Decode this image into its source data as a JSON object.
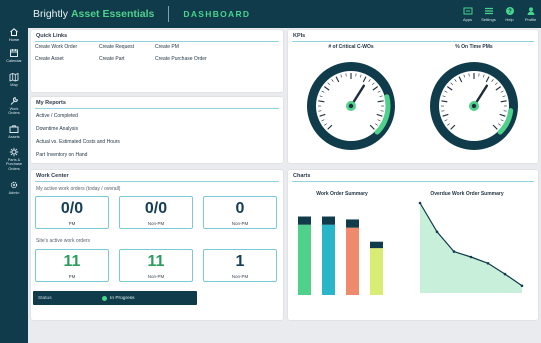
{
  "app": {
    "brand_light": "Brightly ",
    "brand_bold": "Asset Essentials",
    "page": "DASHBOARD"
  },
  "top_actions": [
    {
      "label": "Apps",
      "icon": "apps-icon"
    },
    {
      "label": "Settings",
      "icon": "settings-icon"
    },
    {
      "label": "Help",
      "icon": "help-icon"
    },
    {
      "label": "Profile",
      "icon": "profile-icon"
    }
  ],
  "sidebar": {
    "items": [
      {
        "label": "Menu",
        "icon": "hamburger-icon"
      },
      {
        "label": "Home",
        "icon": "home-icon"
      },
      {
        "label": "Calendar",
        "icon": "calendar-icon"
      },
      {
        "label": "Map",
        "icon": "map-icon"
      },
      {
        "label": "Work Orders",
        "icon": "wrench-icon"
      },
      {
        "label": "Assets",
        "icon": "briefcase-icon"
      },
      {
        "label": "Parts & Purchase Orders",
        "icon": "gear-icon"
      },
      {
        "label": "Admin",
        "icon": "cog-icon"
      }
    ]
  },
  "quick_links": {
    "title": "Quick Links",
    "links": [
      "Create Work Order",
      "Create Request",
      "Create PM",
      "Create Asset",
      "Create Part",
      "Create Purchase Order"
    ]
  },
  "reports": {
    "title": "My Reports",
    "links": [
      "Active / Completed",
      "Downtime Analysis",
      "Actual vs. Estimated Costs and Hours",
      "Part Inventory on Hand"
    ]
  },
  "kpis": {
    "title": "KPIs",
    "gauges": [
      {
        "label": "# of Critical C-WOs",
        "fill_fraction": 0.22
      },
      {
        "label": "% On Time PMs",
        "fill_fraction": 0.14
      }
    ]
  },
  "work_center": {
    "title": "Work Center",
    "my_label": "My active work orders (today / overall)",
    "my_stats": [
      {
        "value": "0/0",
        "label": "PM"
      },
      {
        "value": "0/0",
        "label": "Non-PM"
      },
      {
        "value": "0",
        "label": "Non-PM"
      }
    ],
    "site_label": "Site's active work orders",
    "site_stats": [
      {
        "value": "11",
        "label": "PM"
      },
      {
        "value": "11",
        "label": "Non-PM"
      },
      {
        "value": "1",
        "label": "Non-PM"
      }
    ],
    "status_label": "Status",
    "status_value": "In Progress"
  },
  "charts": {
    "title": "Charts",
    "colors": {
      "teal": "#0f3b4a",
      "green": "#4fd18b",
      "cyan": "#2ab6c9",
      "salmon": "#f08a6c",
      "lime": "#d9ec73"
    },
    "chart_data": [
      {
        "type": "bar",
        "title": "Work Order Summary",
        "values": [
          12,
          12,
          11.5,
          8
        ],
        "cap_values": [
          1.4,
          1.4,
          1.4,
          1.1
        ],
        "bar_colors": [
          "#4fd18b",
          "#2ab6c9",
          "#f08a6c",
          "#d9ec73"
        ],
        "ylim": [
          0,
          14
        ]
      },
      {
        "type": "area",
        "title": "Overdue Work Order Summary",
        "values": [
          100,
          68,
          46,
          40,
          33,
          21,
          8
        ],
        "ylim": [
          0,
          100
        ]
      }
    ]
  }
}
